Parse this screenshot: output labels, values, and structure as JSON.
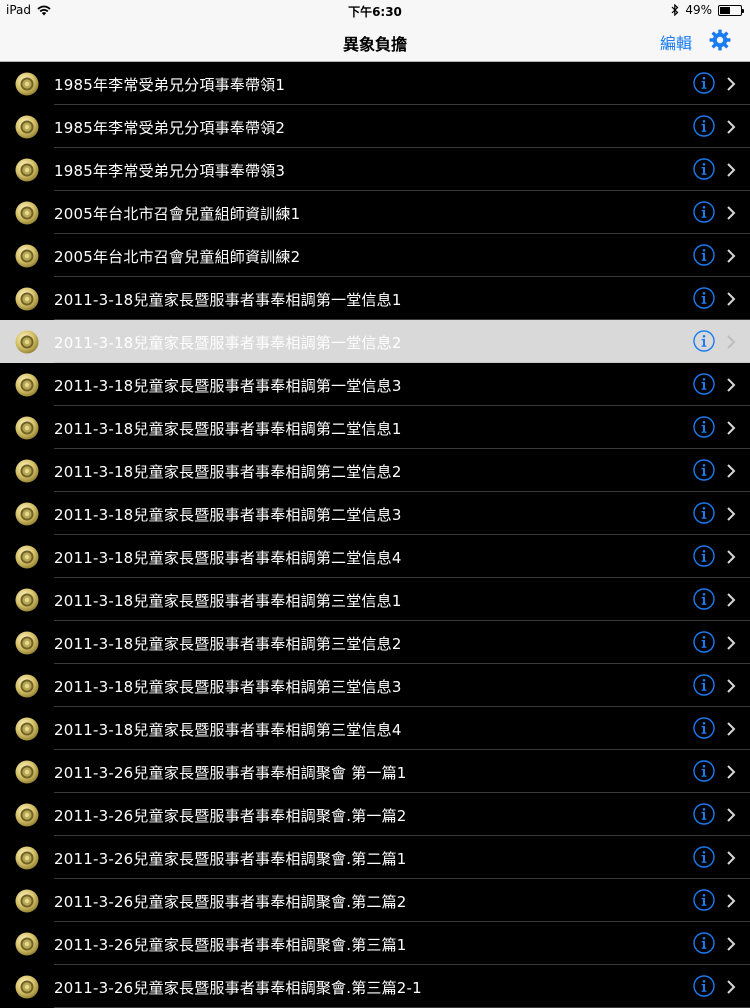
{
  "status_bar": {
    "device": "iPad",
    "time": "下午6:30",
    "battery_percent": "49%",
    "battery_level": 0.49
  },
  "nav": {
    "title": "異象負擔",
    "edit_label": "編輯",
    "settings_icon": "gear-icon"
  },
  "colors": {
    "accent": "#1a7cf5",
    "row_background": "#000000",
    "selected_background": "#d9d9d9",
    "disc_gold": "#c9b85e"
  },
  "list": {
    "selected_index": 6,
    "items": [
      {
        "label": "1985年李常受弟兄分項事奉帶領1"
      },
      {
        "label": "1985年李常受弟兄分項事奉帶領2"
      },
      {
        "label": "1985年李常受弟兄分項事奉帶領3"
      },
      {
        "label": "2005年台北市召會兒童組師資訓練1"
      },
      {
        "label": "2005年台北市召會兒童組師資訓練2"
      },
      {
        "label": "2011-3-18兒童家長暨服事者事奉相調第一堂信息1"
      },
      {
        "label": "2011-3-18兒童家長暨服事者事奉相調第一堂信息2"
      },
      {
        "label": "2011-3-18兒童家長暨服事者事奉相調第一堂信息3"
      },
      {
        "label": "2011-3-18兒童家長暨服事者事奉相調第二堂信息1"
      },
      {
        "label": "2011-3-18兒童家長暨服事者事奉相調第二堂信息2"
      },
      {
        "label": "2011-3-18兒童家長暨服事者事奉相調第二堂信息3"
      },
      {
        "label": "2011-3-18兒童家長暨服事者事奉相調第二堂信息4"
      },
      {
        "label": "2011-3-18兒童家長暨服事者事奉相調第三堂信息1"
      },
      {
        "label": "2011-3-18兒童家長暨服事者事奉相調第三堂信息2"
      },
      {
        "label": "2011-3-18兒童家長暨服事者事奉相調第三堂信息3"
      },
      {
        "label": "2011-3-18兒童家長暨服事者事奉相調第三堂信息4"
      },
      {
        "label": "2011-3-26兒童家長暨服事者事奉相調聚會 第一篇1"
      },
      {
        "label": "2011-3-26兒童家長暨服事者事奉相調聚會.第一篇2"
      },
      {
        "label": "2011-3-26兒童家長暨服事者事奉相調聚會.第二篇1"
      },
      {
        "label": "2011-3-26兒童家長暨服事者事奉相調聚會.第二篇2"
      },
      {
        "label": "2011-3-26兒童家長暨服事者事奉相調聚會.第三篇1"
      },
      {
        "label": "2011-3-26兒童家長暨服事者事奉相調聚會.第三篇2-1"
      }
    ]
  }
}
